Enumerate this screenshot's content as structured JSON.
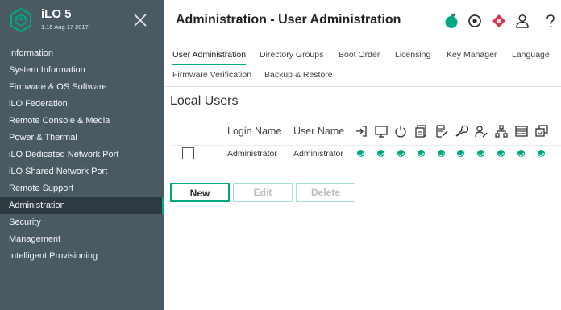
{
  "brand": {
    "title": "iLO 5",
    "subtitle": "1.15 Aug 17 2017",
    "accent_color": "#01a982"
  },
  "sidebar": {
    "close_icon": "close-icon",
    "items": [
      {
        "label": "Information"
      },
      {
        "label": "System Information"
      },
      {
        "label": "Firmware & OS Software"
      },
      {
        "label": "iLO Federation"
      },
      {
        "label": "Remote Console & Media"
      },
      {
        "label": "Power & Thermal"
      },
      {
        "label": "iLO Dedicated Network Port"
      },
      {
        "label": "iLO Shared Network Port"
      },
      {
        "label": "Remote Support"
      },
      {
        "label": "Administration",
        "active": true
      },
      {
        "label": "Security"
      },
      {
        "label": "Management"
      },
      {
        "label": "Intelligent Provisioning"
      }
    ]
  },
  "header": {
    "title": "Administration - User Administration",
    "icons": [
      "power-status-icon",
      "target-icon",
      "health-alert-icon",
      "user-icon",
      "help-icon"
    ]
  },
  "tabs": [
    {
      "label": "User Administration",
      "active": true
    },
    {
      "label": "Directory Groups"
    },
    {
      "label": "Boot Order"
    },
    {
      "label": "Licensing"
    },
    {
      "label": "Key Manager"
    },
    {
      "label": "Language"
    },
    {
      "label": "Firmware Verification"
    },
    {
      "label": "Backup & Restore"
    }
  ],
  "local_users": {
    "title": "Local Users",
    "columns": {
      "login_name": "Login Name",
      "user_name": "User Name"
    },
    "privilege_icons": [
      "login-privilege-icon",
      "remote-console-icon",
      "virtual-power-icon",
      "virtual-media-icon",
      "host-bios-icon",
      "configure-ilo-icon",
      "administer-users-icon",
      "host-nic-icon",
      "host-storage-icon",
      "recovery-set-icon"
    ],
    "rows": [
      {
        "login_name": "Administrator",
        "user_name": "Administrator",
        "privileges": [
          true,
          true,
          true,
          true,
          true,
          true,
          true,
          true,
          true,
          true
        ]
      }
    ],
    "buttons": {
      "new": "New",
      "edit": "Edit",
      "delete": "Delete"
    }
  }
}
